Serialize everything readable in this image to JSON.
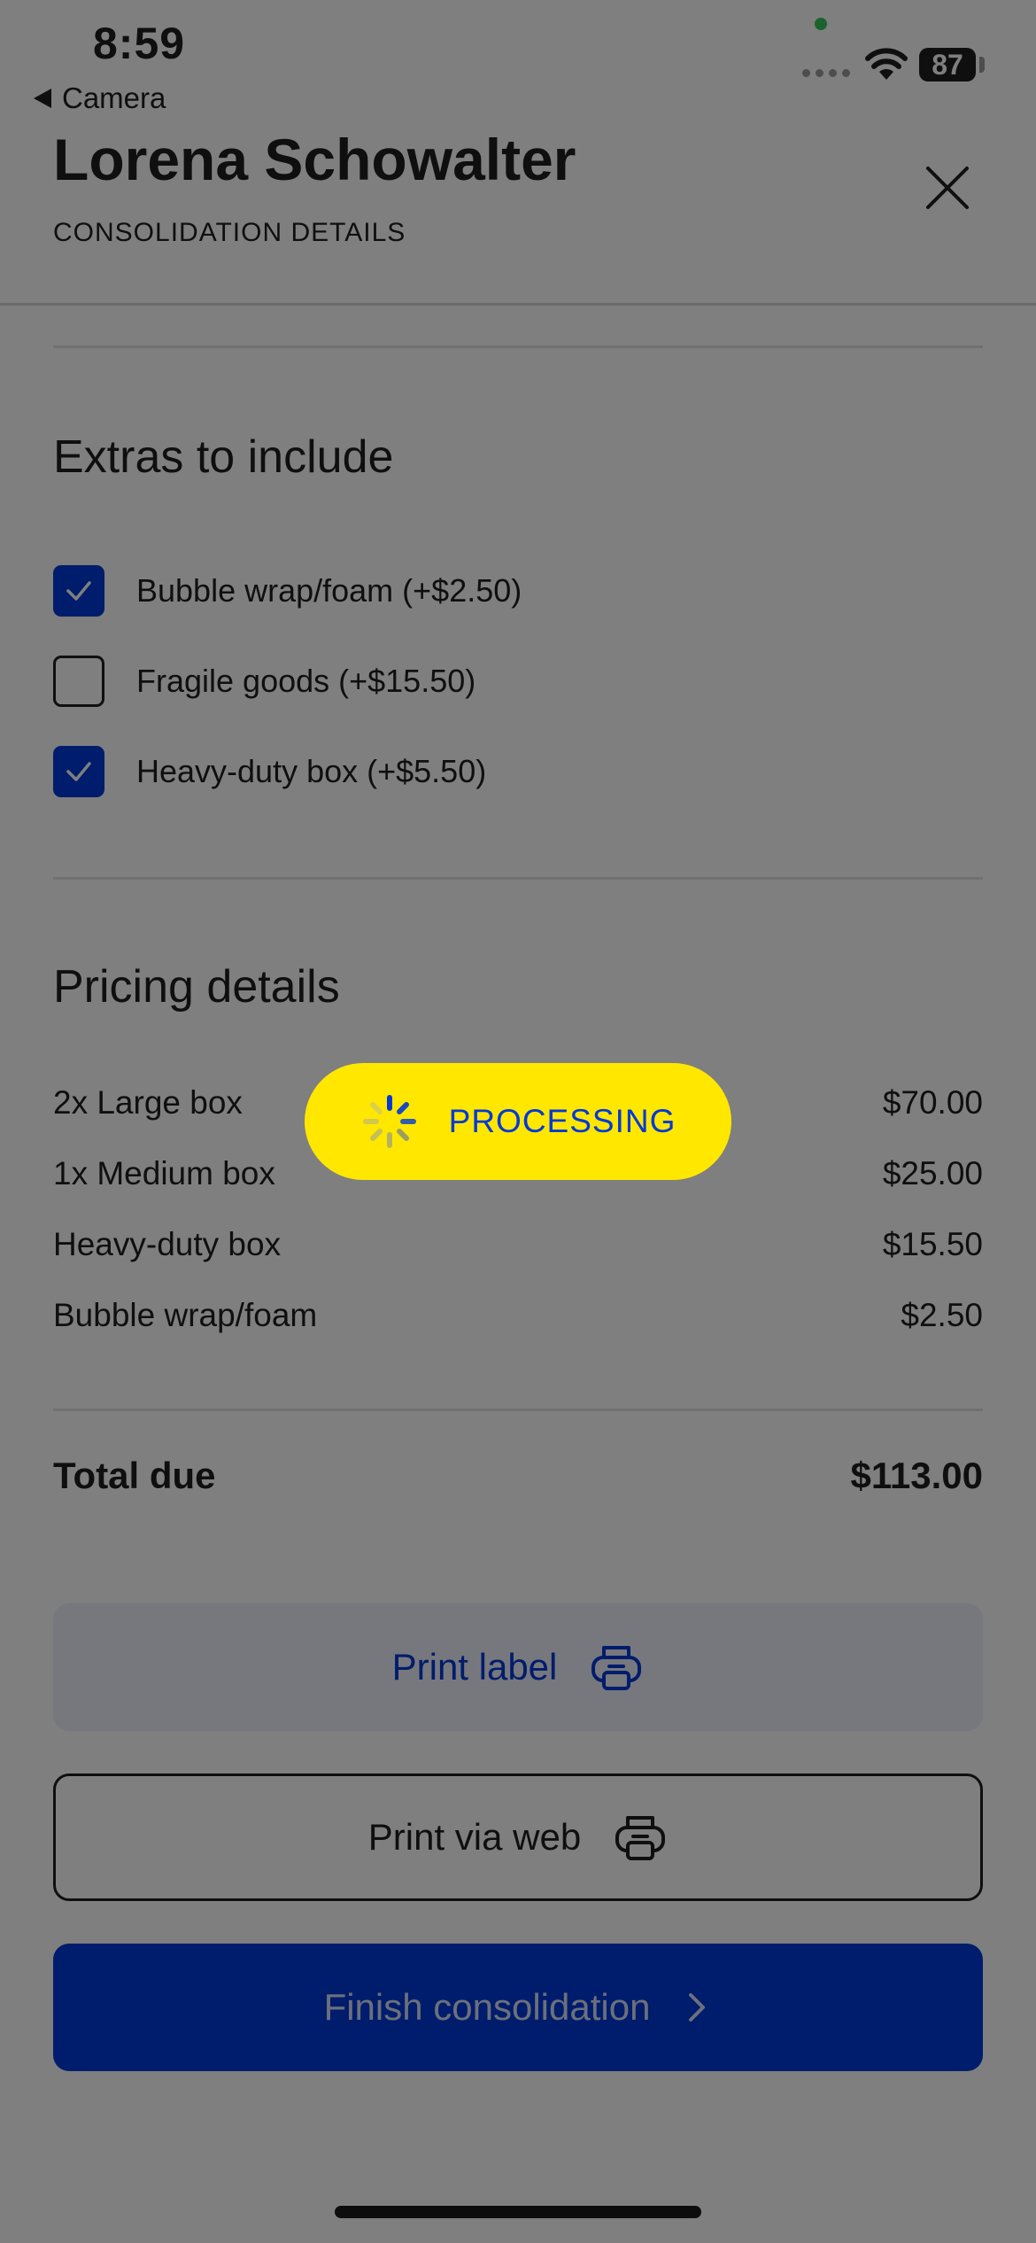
{
  "status_bar": {
    "time": "8:59",
    "back_label": "Camera",
    "battery": "87"
  },
  "header": {
    "title": "Lorena Schowalter",
    "subtitle": "CONSOLIDATION DETAILS"
  },
  "extras": {
    "title": "Extras to include",
    "items": [
      {
        "label": "Bubble wrap/foam (+$2.50)",
        "checked": true
      },
      {
        "label": "Fragile goods (+$15.50)",
        "checked": false
      },
      {
        "label": "Heavy-duty box (+$5.50)",
        "checked": true
      }
    ]
  },
  "pricing": {
    "title": "Pricing details",
    "rows": [
      {
        "label": "2x Large box",
        "amount": "$70.00"
      },
      {
        "label": "1x Medium box",
        "amount": "$25.00"
      },
      {
        "label": "Heavy-duty box",
        "amount": "$15.50"
      },
      {
        "label": "Bubble wrap/foam",
        "amount": "$2.50"
      }
    ],
    "total_label": "Total due",
    "total_amount": "$113.00"
  },
  "actions": {
    "print_label": "Print label",
    "print_web": "Print via web",
    "finish": "Finish consolidation"
  },
  "toast": {
    "label": "PROCESSING"
  },
  "colors": {
    "primary": "#0039d8",
    "toast": "#ffe700",
    "overlay": "rgba(0,0,0,0.5)"
  },
  "icons": {
    "close": "close-icon",
    "printer": "printer-icon",
    "chevron": "chevron-right-icon",
    "spinner": "spinner-icon",
    "check": "check-icon"
  }
}
